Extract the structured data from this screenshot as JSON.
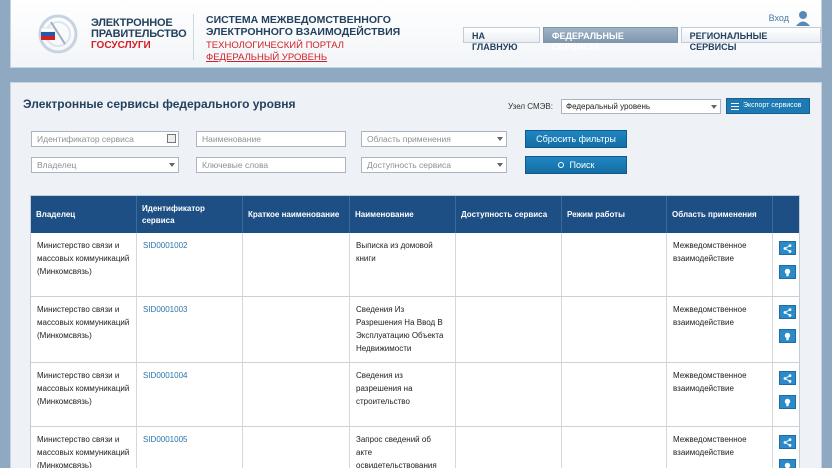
{
  "header": {
    "logo_line1": "ЭЛЕКТРОННОЕ",
    "logo_line2": "ПРАВИТЕЛЬСТВО",
    "logo_line3": "ГОСУСЛУГИ",
    "system_title_line1": "СИСТЕМА МЕЖВЕДОМСТВЕННОГО",
    "system_title_line2": "ЭЛЕКТРОННОГО ВЗАИМОДЕЙСТВИЯ",
    "portal_name": "ТЕХНОЛОГИЧЕСКИЙ ПОРТАЛ",
    "portal_level": "ФЕДЕРАЛЬНЫЙ УРОВЕНЬ",
    "login_label": "Вход",
    "nav": [
      {
        "label": "НА ГЛАВНУЮ"
      },
      {
        "label": "ФЕДЕРАЛЬНЫЕ СЕРВИСЫ",
        "active": true
      },
      {
        "label": "РЕГИОНАЛЬНЫЕ СЕРВИСЫ"
      }
    ]
  },
  "main": {
    "title": "Электронные сервисы федерального уровня",
    "node_label": "Узел СМЭВ:",
    "node_value": "Федеральный уровень",
    "export_label": "Экспорт сервисов"
  },
  "filters": {
    "service_id_placeholder": "Идентификатор сервиса",
    "name_placeholder": "Наименование",
    "scope_placeholder": "Область применения",
    "owner_placeholder": "Владелец",
    "keywords_placeholder": "Ключевые слова",
    "availability_placeholder": "Доступность сервиса",
    "reset_label": "Сбросить фильтры",
    "search_label": "Поиск"
  },
  "table": {
    "headers": [
      "Владелец",
      "Идентификатор сервиса",
      "Краткое наименование",
      "Наименование",
      "Доступность сервиса",
      "Режим работы",
      "Область применения"
    ],
    "rows": [
      {
        "owner": "Министерство связи и массовых коммуникаций (Минкомсвязь)",
        "sid": "SID0001002",
        "short": "",
        "name": "Выписка из домовой книги",
        "availability": "",
        "mode": "",
        "scope": "Межведомственное взаимодействие"
      },
      {
        "owner": "Министерство связи и массовых коммуникаций (Минкомсвязь)",
        "sid": "SID0001003",
        "short": "",
        "name": "Сведения Из Разрешения На Ввод В Эксплуатацию Объекта Недвижимости",
        "availability": "",
        "mode": "",
        "scope": "Межведомственное взаимодействие"
      },
      {
        "owner": "Министерство связи и массовых коммуникаций (Минкомсвязь)",
        "sid": "SID0001004",
        "short": "",
        "name": "Сведения из разрешения на строительство",
        "availability": "",
        "mode": "",
        "scope": "Межведомственное взаимодействие"
      },
      {
        "owner": "Министерство связи и массовых коммуникаций (Минкомсвязь)",
        "sid": "SID0001005",
        "short": "",
        "name": "Запрос сведений об акте освидетельствования проведения основных",
        "availability": "",
        "mode": "",
        "scope": "Межведомственное взаимодействие"
      }
    ]
  },
  "colors": {
    "brand_blue": "#1d4f84",
    "accent_blue": "#1f87c4",
    "brand_red": "#d31e25"
  }
}
